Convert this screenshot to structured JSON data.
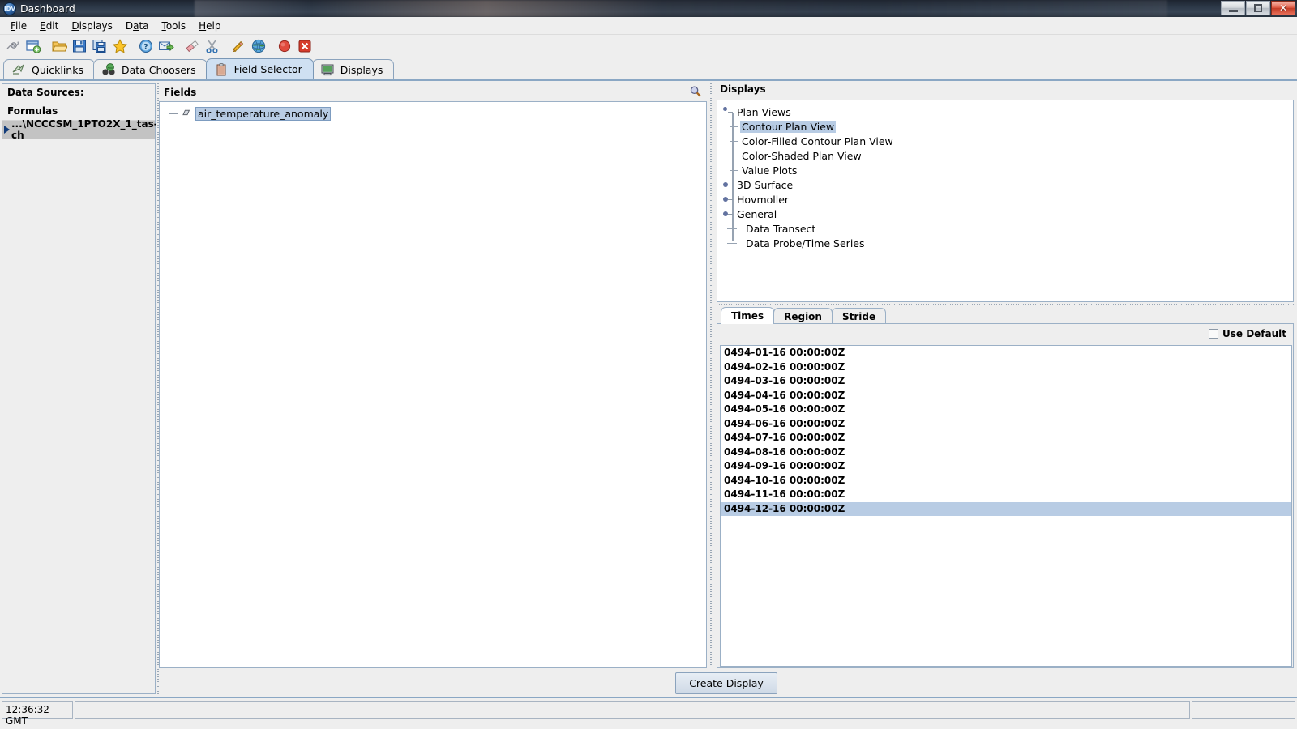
{
  "window": {
    "title": "Dashboard",
    "app_icon": "idv-globe-icon",
    "controls": {
      "minimize": "minimize-button",
      "maximize": "maximize-button",
      "close": "close-button"
    }
  },
  "menubar": {
    "items": [
      {
        "label": "File",
        "mnemonic": "F"
      },
      {
        "label": "Edit",
        "mnemonic": "E"
      },
      {
        "label": "Displays",
        "mnemonic": "D"
      },
      {
        "label": "Data",
        "mnemonic": "a"
      },
      {
        "label": "Tools",
        "mnemonic": "T"
      },
      {
        "label": "Help",
        "mnemonic": "H"
      }
    ]
  },
  "toolbar": {
    "buttons": [
      {
        "name": "connect-data-icon",
        "tip": "Connect to data"
      },
      {
        "name": "new-window-icon",
        "tip": "New window"
      },
      {
        "name": "open-folder-icon",
        "tip": "Open"
      },
      {
        "name": "save-icon",
        "tip": "Save"
      },
      {
        "name": "save-as-icon",
        "tip": "Save as"
      },
      {
        "name": "favorite-star-icon",
        "tip": "Favorites"
      },
      {
        "name": "help-icon",
        "tip": "Help"
      },
      {
        "name": "send-mail-icon",
        "tip": "Send"
      },
      {
        "name": "eraser-icon",
        "tip": "Remove all displays"
      },
      {
        "name": "scissors-icon",
        "tip": "Cut"
      },
      {
        "name": "pencil-icon",
        "tip": "Edit"
      },
      {
        "name": "globe-icon",
        "tip": "Show globe"
      },
      {
        "name": "stop-record-icon",
        "tip": "Stop"
      },
      {
        "name": "exit-icon",
        "tip": "Exit"
      }
    ]
  },
  "tabs": {
    "items": [
      {
        "label": "Quicklinks",
        "icon": "quicklinks-icon",
        "active": false
      },
      {
        "label": "Data Choosers",
        "icon": "binoculars-icon",
        "active": false
      },
      {
        "label": "Field Selector",
        "icon": "clipboard-icon",
        "active": true
      },
      {
        "label": "Displays",
        "icon": "monitor-icon",
        "active": false
      }
    ]
  },
  "data_sources": {
    "header": "Data Sources:",
    "items": [
      {
        "label": "Formulas",
        "selected": false,
        "expandable": false
      },
      {
        "label": "...\\NCCCSM_1PTO2X_1_tas-ch",
        "selected": true,
        "expandable": true
      }
    ]
  },
  "fields": {
    "header": "Fields",
    "search_icon": "magnifier-icon",
    "items": [
      {
        "label": "air_temperature_anomaly",
        "selected": true
      }
    ]
  },
  "displays": {
    "header": "Displays",
    "tree": [
      {
        "label": "Plan Views",
        "level": 0,
        "expanded": true,
        "selected": false
      },
      {
        "label": "Contour Plan View",
        "level": 1,
        "expanded": false,
        "selected": true
      },
      {
        "label": "Color-Filled Contour Plan View",
        "level": 1,
        "expanded": false,
        "selected": false
      },
      {
        "label": "Color-Shaded Plan View",
        "level": 1,
        "expanded": false,
        "selected": false
      },
      {
        "label": "Value Plots",
        "level": 1,
        "expanded": false,
        "selected": false,
        "last": true
      },
      {
        "label": "3D Surface",
        "level": 0,
        "expanded": false,
        "selected": false
      },
      {
        "label": "Hovmoller",
        "level": 0,
        "expanded": false,
        "selected": false
      },
      {
        "label": "General",
        "level": 0,
        "expanded": false,
        "selected": false
      },
      {
        "label": "Data Transect",
        "level": 0,
        "leaf": true,
        "selected": false
      },
      {
        "label": "Data Probe/Time Series",
        "level": 0,
        "leaf": true,
        "selected": false,
        "last": true
      }
    ]
  },
  "subset": {
    "tabs": [
      {
        "label": "Times",
        "active": true
      },
      {
        "label": "Region",
        "active": false
      },
      {
        "label": "Stride",
        "active": false
      }
    ],
    "use_default": {
      "label": "Use Default",
      "checked": false
    },
    "times": [
      {
        "label": "0494-01-16 00:00:00Z",
        "selected": false
      },
      {
        "label": "0494-02-16 00:00:00Z",
        "selected": false
      },
      {
        "label": "0494-03-16 00:00:00Z",
        "selected": false
      },
      {
        "label": "0494-04-16 00:00:00Z",
        "selected": false
      },
      {
        "label": "0494-05-16 00:00:00Z",
        "selected": false
      },
      {
        "label": "0494-06-16 00:00:00Z",
        "selected": false
      },
      {
        "label": "0494-07-16 00:00:00Z",
        "selected": false
      },
      {
        "label": "0494-08-16 00:00:00Z",
        "selected": false
      },
      {
        "label": "0494-09-16 00:00:00Z",
        "selected": false
      },
      {
        "label": "0494-10-16 00:00:00Z",
        "selected": false
      },
      {
        "label": "0494-11-16 00:00:00Z",
        "selected": false
      },
      {
        "label": "0494-12-16 00:00:00Z",
        "selected": true
      }
    ]
  },
  "actions": {
    "create_display": "Create Display"
  },
  "status": {
    "clock": "12:36:32 GMT",
    "message": ""
  },
  "colors": {
    "selection": "#b8cce4",
    "tab_active": "#cfe0f2",
    "panel_bg": "#eeeeee",
    "border": "#9bb0c6",
    "titlebar": "#2c3847",
    "close_button": "#c33c26"
  }
}
